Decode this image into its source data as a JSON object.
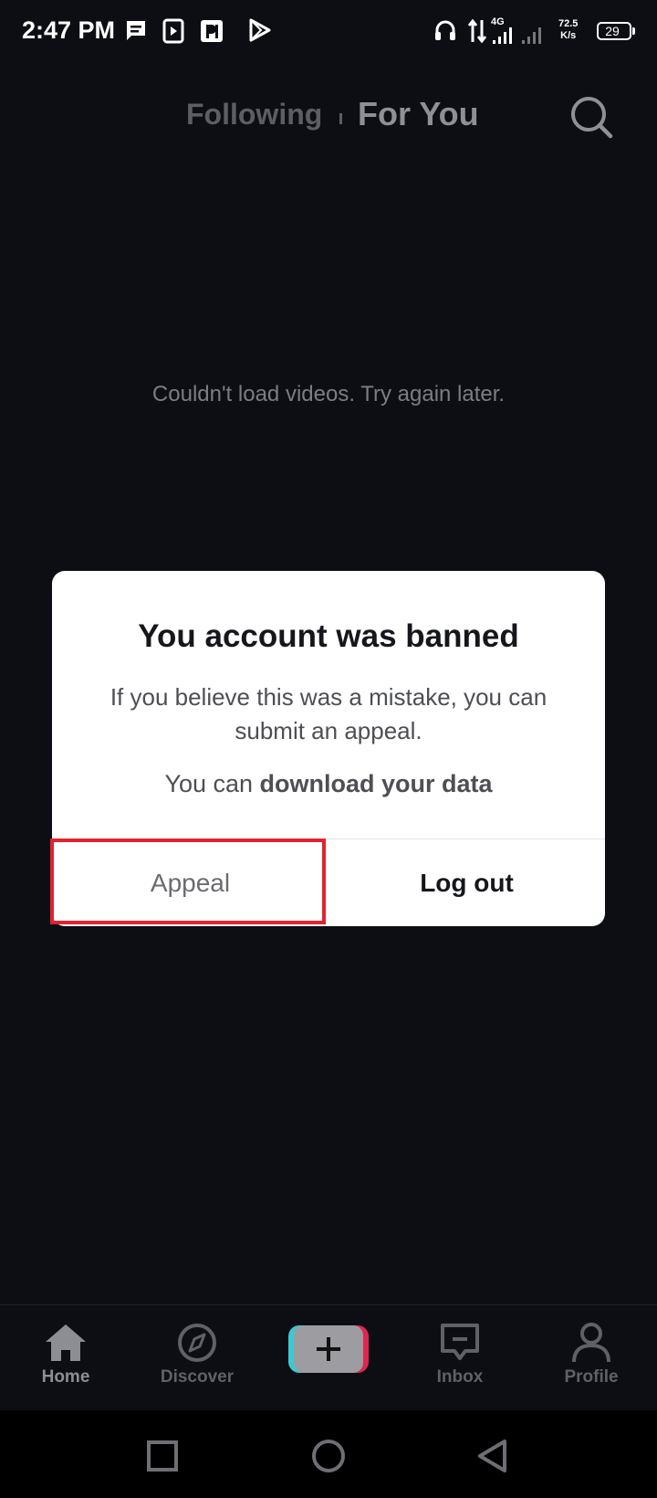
{
  "status_bar": {
    "time": "2:47 PM",
    "network_type": "4G",
    "speed_value": "72.5",
    "speed_unit": "K/s",
    "battery": "29",
    "icons": [
      "message-icon",
      "media-icon",
      "parking-app-icon",
      "play-store-icon",
      "headset-icon",
      "data-arrows-icon",
      "signal-icon",
      "battery-icon"
    ]
  },
  "top_nav": {
    "following": "Following",
    "for_you": "For You",
    "search_icon": "search-icon"
  },
  "feed": {
    "error_message": "Couldn't load videos. Try again later."
  },
  "dialog": {
    "title": "You account was banned",
    "message": "If you believe this was a mistake, you can submit an appeal.",
    "data_prefix": "You can ",
    "data_link": "download your data",
    "appeal_button": "Appeal",
    "logout_button": "Log out",
    "highlight_color": "#e02331"
  },
  "bottom_nav": {
    "home": "Home",
    "discover": "Discover",
    "inbox": "Inbox",
    "profile": "Profile",
    "create_icon": "plus-icon"
  },
  "system_nav": {
    "icons": [
      "recents-square-icon",
      "home-circle-icon",
      "back-triangle-icon"
    ]
  }
}
